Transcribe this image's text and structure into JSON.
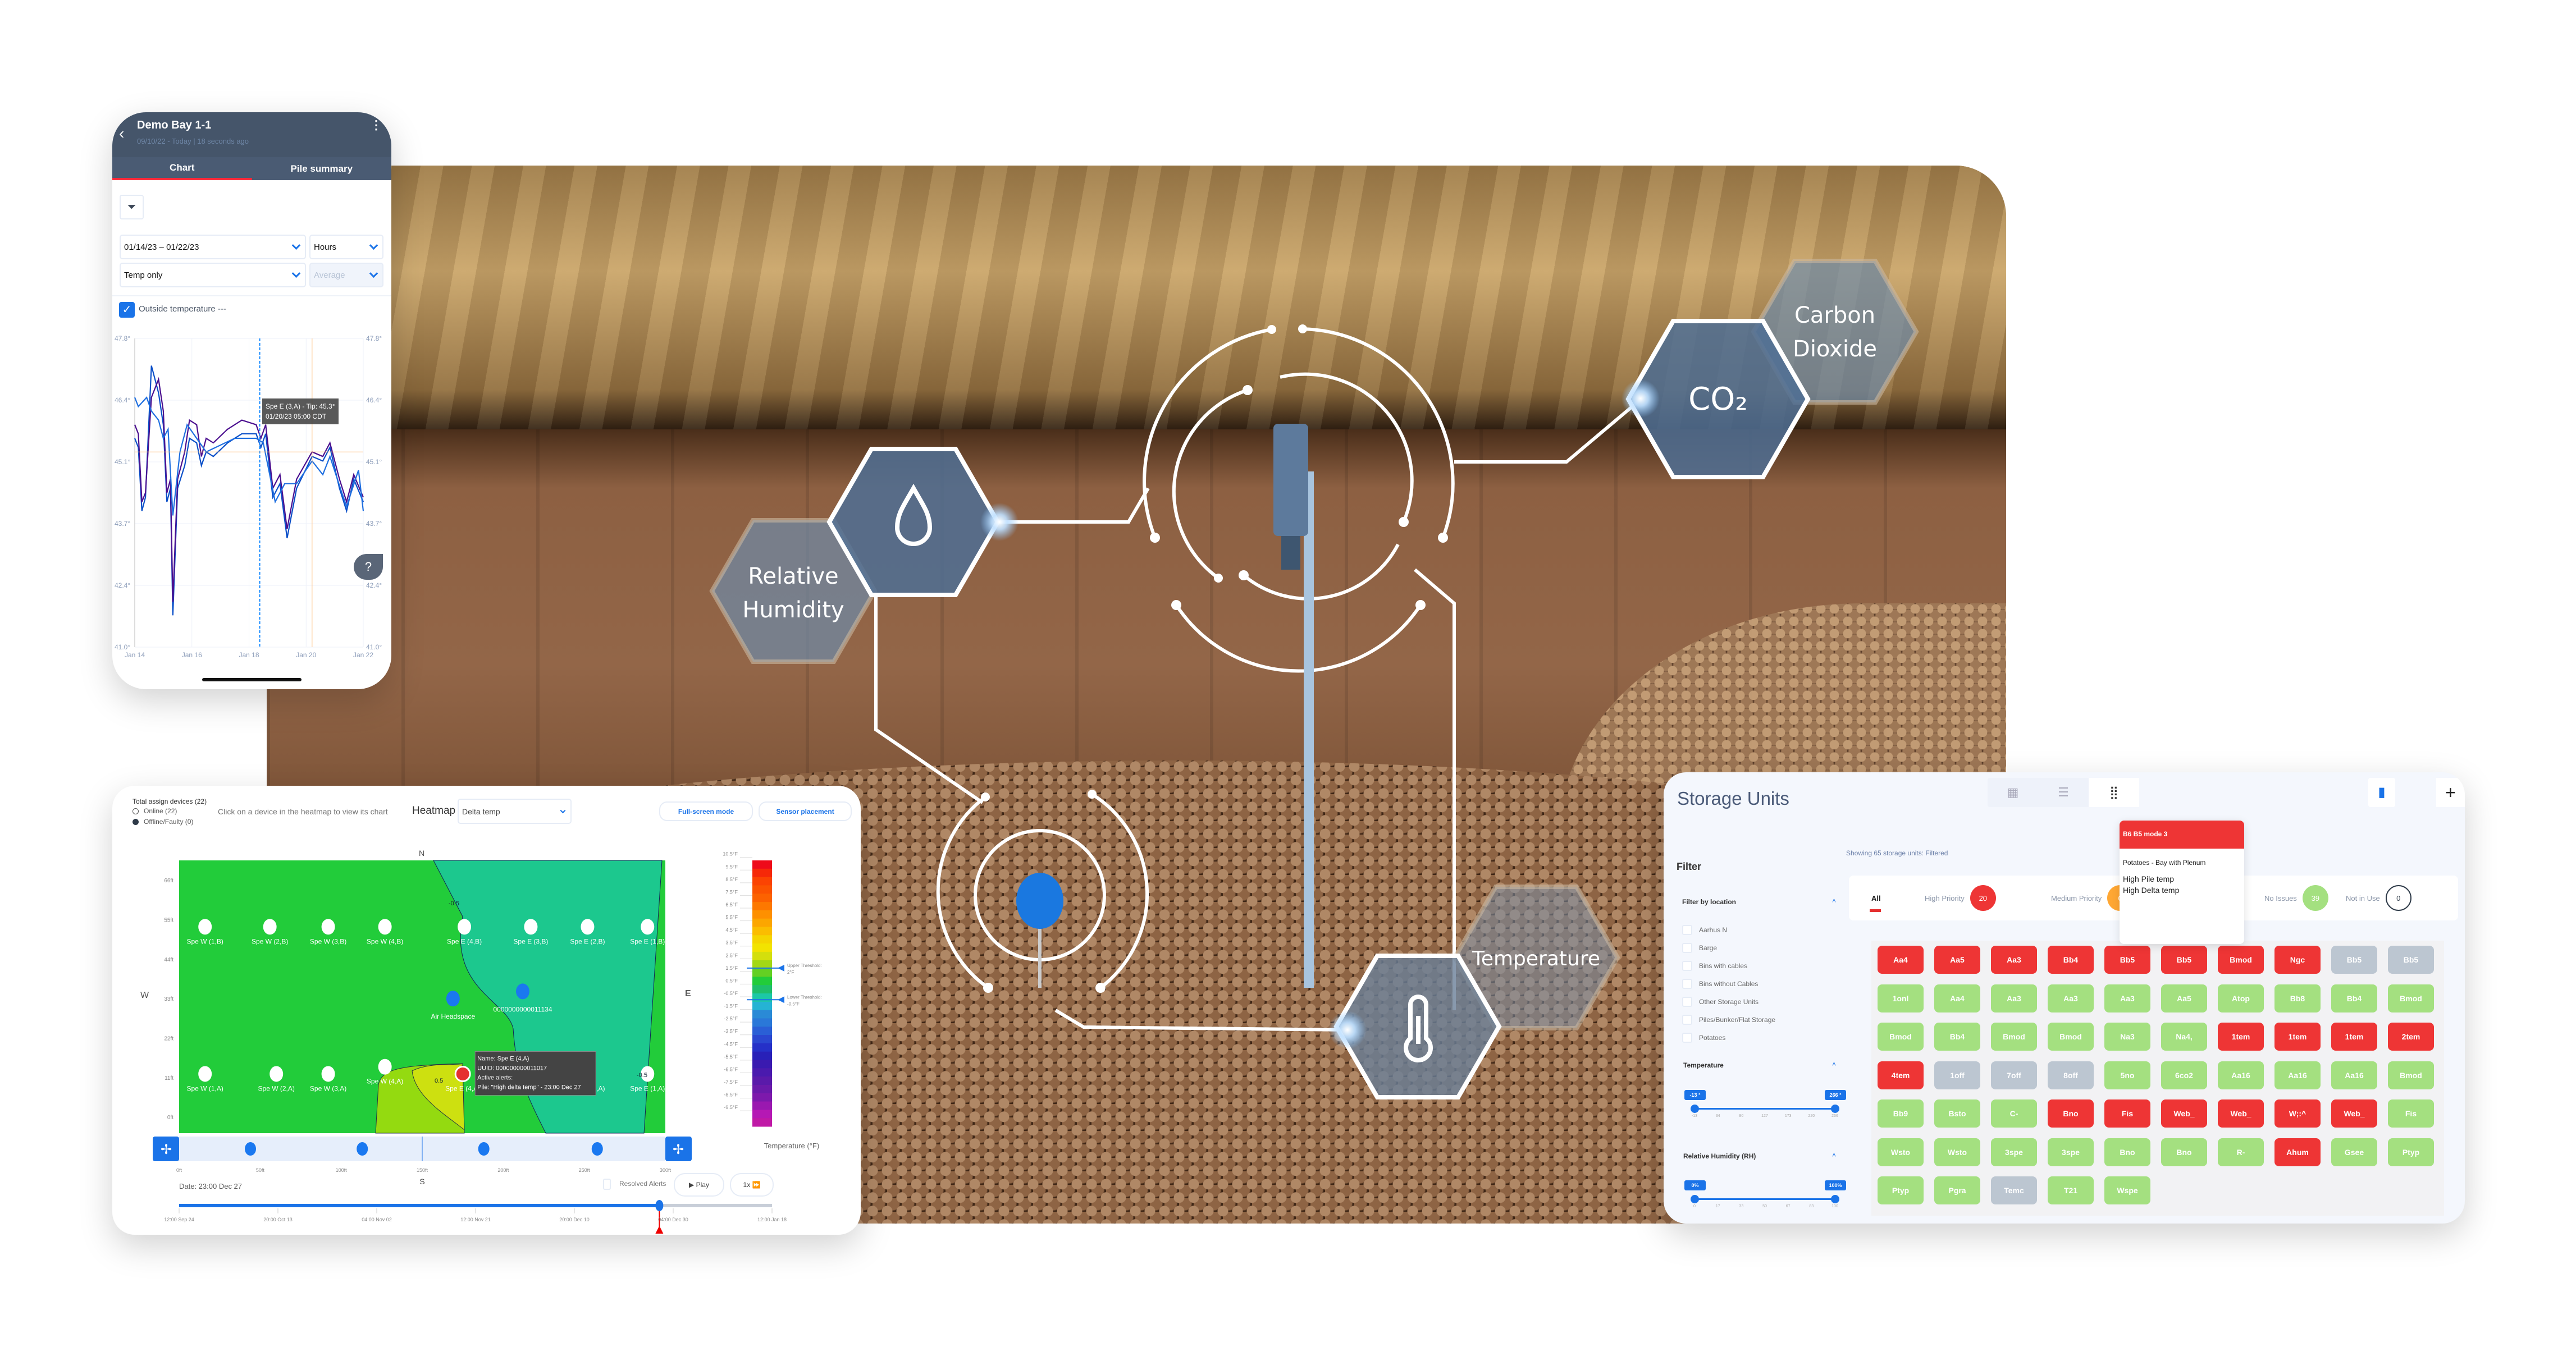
{
  "colors": {
    "accent": "#1a73e8",
    "alert": "#ee3535",
    "ok": "#a4e080",
    "off": "#bcc6d1",
    "header": "#45556a",
    "warn": "#ffa733"
  },
  "overlay": {
    "rh_label": [
      "Relative",
      "Humidity"
    ],
    "co2_symbol": "CO₂",
    "co2_label": [
      "Carbon",
      "Dioxide"
    ],
    "temp_label": "Temperature",
    "icons": [
      "droplet-icon",
      "thermometer-icon"
    ]
  },
  "phone": {
    "title": "Demo Bay 1-1",
    "subtitle": "09/10/22 - Today | 18 seconds ago",
    "tabs": [
      {
        "label": "Chart",
        "active": true
      },
      {
        "label": "Pile summary",
        "active": false
      }
    ],
    "date_range": "01/14/23 – 01/22/23",
    "interval": "Hours",
    "mode": "Temp only",
    "aggregate_placeholder": "Average",
    "outside_temp_label": "Outside temperature ---",
    "outside_temp_checked": true,
    "tooltip": [
      "Spe E (3,A) - Tip: 45.3°",
      "01/20/23 05:00  CDT"
    ]
  },
  "chart_data": {
    "type": "line",
    "title": "",
    "xlabel": "",
    "ylabel": "",
    "ylim": [
      41.0,
      47.8
    ],
    "yticks": [
      "47.8°",
      "46.4°",
      "45.1°",
      "43.7°",
      "42.4°",
      "41.0°"
    ],
    "xlim": [
      "2023-01-14T00:00",
      "2023-01-22T00:00"
    ],
    "xticks": [
      "Jan 14",
      "Jan 16",
      "Jan 18",
      "Jan 20",
      "Jan 22"
    ],
    "grid": true,
    "cursor_x": "2023-01-18T09:00",
    "hover": {
      "x": "2023-01-20T05:00",
      "y": 45.3
    },
    "series": [
      {
        "color": "#0a4fc8",
        "points": [
          [
            "2023-01-14T00:00",
            45.6
          ],
          [
            "2023-01-14T03:00",
            45.4
          ],
          [
            "2023-01-14T06:00",
            44.0
          ],
          [
            "2023-01-14T09:00",
            44.3
          ],
          [
            "2023-01-14T14:00",
            47.2
          ],
          [
            "2023-01-14T20:00",
            46.6
          ],
          [
            "2023-01-15T00:00",
            45.9
          ],
          [
            "2023-01-15T03:00",
            44.2
          ],
          [
            "2023-01-15T06:00",
            44.5
          ],
          [
            "2023-01-15T08:00",
            41.7
          ],
          [
            "2023-01-15T12:00",
            44.5
          ],
          [
            "2023-01-15T18:00",
            45.0
          ],
          [
            "2023-01-15T22:00",
            45.6
          ],
          [
            "2023-01-16T04:00",
            45.5
          ],
          [
            "2023-01-16T08:00",
            45.0
          ],
          [
            "2023-01-16T12:00",
            45.3
          ],
          [
            "2023-01-16T18:00",
            45.2
          ],
          [
            "2023-01-17T06:00",
            45.5
          ],
          [
            "2023-01-17T18:00",
            45.7
          ],
          [
            "2023-01-18T06:00",
            45.7
          ],
          [
            "2023-01-18T10:00",
            45.4
          ],
          [
            "2023-01-18T14:00",
            45.7
          ],
          [
            "2023-01-18T20:00",
            44.3
          ],
          [
            "2023-01-19T02:00",
            44.6
          ],
          [
            "2023-01-19T08:00",
            43.4
          ],
          [
            "2023-01-19T16:00",
            44.5
          ],
          [
            "2023-01-20T05:00",
            45.2
          ],
          [
            "2023-01-20T14:00",
            45.1
          ],
          [
            "2023-01-20T20:00",
            45.4
          ],
          [
            "2023-01-21T04:00",
            44.5
          ],
          [
            "2023-01-21T10:00",
            44.0
          ],
          [
            "2023-01-21T16:00",
            44.7
          ],
          [
            "2023-01-22T00:00",
            44.2
          ]
        ]
      },
      {
        "color": "#4b0f8f",
        "points": [
          [
            "2023-01-14T00:00",
            45.9
          ],
          [
            "2023-01-14T03:00",
            45.7
          ],
          [
            "2023-01-14T06:00",
            44.2
          ],
          [
            "2023-01-14T09:00",
            44.4
          ],
          [
            "2023-01-14T14:00",
            46.5
          ],
          [
            "2023-01-14T20:00",
            46.9
          ],
          [
            "2023-01-15T00:00",
            46.2
          ],
          [
            "2023-01-15T03:00",
            44.4
          ],
          [
            "2023-01-15T06:00",
            44.7
          ],
          [
            "2023-01-15T08:00",
            42.0
          ],
          [
            "2023-01-15T12:00",
            44.7
          ],
          [
            "2023-01-15T18:00",
            45.3
          ],
          [
            "2023-01-15T22:00",
            46.0
          ],
          [
            "2023-01-16T04:00",
            45.9
          ],
          [
            "2023-01-16T08:00",
            45.2
          ],
          [
            "2023-01-16T12:00",
            45.6
          ],
          [
            "2023-01-16T18:00",
            45.5
          ],
          [
            "2023-01-17T06:00",
            45.8
          ],
          [
            "2023-01-17T18:00",
            46.0
          ],
          [
            "2023-01-18T06:00",
            45.9
          ],
          [
            "2023-01-18T10:00",
            45.6
          ],
          [
            "2023-01-18T14:00",
            45.9
          ],
          [
            "2023-01-18T20:00",
            44.5
          ],
          [
            "2023-01-19T02:00",
            44.8
          ],
          [
            "2023-01-19T08:00",
            43.6
          ],
          [
            "2023-01-19T16:00",
            44.7
          ],
          [
            "2023-01-20T05:00",
            45.3
          ],
          [
            "2023-01-20T14:00",
            45.2
          ],
          [
            "2023-01-20T20:00",
            45.5
          ],
          [
            "2023-01-21T04:00",
            44.7
          ],
          [
            "2023-01-21T10:00",
            44.2
          ],
          [
            "2023-01-21T16:00",
            44.8
          ],
          [
            "2023-01-22T00:00",
            44.3
          ]
        ]
      },
      {
        "color": "#1f6fe0",
        "points": [
          [
            "2023-01-14T00:00",
            46.5
          ],
          [
            "2023-01-14T03:00",
            46.3
          ],
          [
            "2023-01-14T10:00",
            46.5
          ],
          [
            "2023-01-14T14:00",
            46.2
          ],
          [
            "2023-01-14T20:00",
            46.0
          ],
          [
            "2023-01-15T00:00",
            45.6
          ],
          [
            "2023-01-15T04:00",
            45.8
          ],
          [
            "2023-01-15T08:00",
            43.9
          ],
          [
            "2023-01-15T14:00",
            45.3
          ],
          [
            "2023-01-15T20:00",
            45.9
          ],
          [
            "2023-01-16T04:00",
            45.6
          ],
          [
            "2023-01-16T12:00",
            45.3
          ],
          [
            "2023-01-16T20:00",
            45.4
          ],
          [
            "2023-01-17T12:00",
            45.6
          ],
          [
            "2023-01-18T06:00",
            45.6
          ],
          [
            "2023-01-18T12:00",
            45.5
          ],
          [
            "2023-01-18T22:00",
            44.2
          ],
          [
            "2023-01-19T06:00",
            44.6
          ],
          [
            "2023-01-19T16:00",
            44.6
          ],
          [
            "2023-01-20T05:00",
            45.1
          ],
          [
            "2023-01-20T14:00",
            44.8
          ],
          [
            "2023-01-20T20:00",
            45.2
          ],
          [
            "2023-01-21T06:00",
            44.4
          ],
          [
            "2023-01-21T10:00",
            44.1
          ],
          [
            "2023-01-21T20:00",
            44.9
          ],
          [
            "2023-01-22T00:00",
            44.0
          ]
        ]
      }
    ]
  },
  "heatmap": {
    "total_devices": "Total assign devices (22)",
    "online": "Online (22)",
    "offline": "Offline/Faulty (0)",
    "hint": "Click on a device in the heatmap to view its chart",
    "label": "Heatmap",
    "metric": "Delta temp",
    "fullscreen": "Full-screen mode",
    "sensor_placement": "Sensor placement",
    "compass": {
      "n": "N",
      "s": "S",
      "w": "W",
      "e": "E"
    },
    "xlim": [
      0,
      300
    ],
    "ylim": [
      -4.5,
      71.5
    ],
    "yticks": [
      "66ft",
      "55ft",
      "44ft",
      "33ft",
      "22ft",
      "11ft",
      "0ft"
    ],
    "xticks": [
      "0ft",
      "50ft",
      "100ft",
      "150ft",
      "200ft",
      "250ft",
      "300ft"
    ],
    "sensors": [
      {
        "name": "Spe W (1,B)",
        "x": 16,
        "y": 53
      },
      {
        "name": "Spe W (2,B)",
        "x": 56,
        "y": 53
      },
      {
        "name": "Spe W (3,B)",
        "x": 92,
        "y": 53
      },
      {
        "name": "Spe W (4,B)",
        "x": 127,
        "y": 53
      },
      {
        "name": "Spe E (4,B)",
        "x": 176,
        "y": 53
      },
      {
        "name": "Spe E (3,B)",
        "x": 217,
        "y": 53
      },
      {
        "name": "Spe E (2,B)",
        "x": 252,
        "y": 53
      },
      {
        "name": "Spe E (1,B)",
        "x": 289,
        "y": 53
      },
      {
        "name": "Spe W (1,A)",
        "x": 16,
        "y": 12
      },
      {
        "name": "Spe W (2,A)",
        "x": 60,
        "y": 12
      },
      {
        "name": "Spe W (3,A)",
        "x": 92,
        "y": 12
      },
      {
        "name": "Spe W (4,A)",
        "x": 127,
        "y": 14
      },
      {
        "name": "Spe E (4,A)",
        "x": 175,
        "y": 12,
        "alert": true
      },
      {
        "name": "Spe E (3,A)",
        "x": 217,
        "y": 12
      },
      {
        "name": "Spe E (2,A)",
        "x": 252,
        "y": 12
      },
      {
        "name": "Spe E (1,A)",
        "x": 289,
        "y": 12
      }
    ],
    "co2_sensors": [
      {
        "name": "Air Headspace",
        "x": 169,
        "y": 33
      },
      {
        "name": "0000000000011134",
        "x": 212,
        "y": 35
      }
    ],
    "contour_labels": [
      "-0.5",
      "0.5",
      "-0.5"
    ],
    "tooltip": [
      "Name: Spe E (4,A)",
      "UUID: 000000000011017",
      "Active alerts:",
      "Pile: \"High delta temp\" - 23:00 Dec 27"
    ],
    "colorbar": {
      "ticks": [
        "10.5°F",
        "9.5°F",
        "8.5°F",
        "7.5°F",
        "6.5°F",
        "5.5°F",
        "4.5°F",
        "3.5°F",
        "2.5°F",
        "1.5°F",
        "0.5°F",
        "-0.5°F",
        "-1.5°F",
        "-2.5°F",
        "-3.5°F",
        "-4.5°F",
        "-5.5°F",
        "-6.5°F",
        "-7.5°F",
        "-8.5°F",
        "-9.5°F"
      ],
      "range": [
        -10.5,
        10.5
      ],
      "colors": [
        "#ee0a1a",
        "#f62808",
        "#fb4302",
        "#fb5300",
        "#fc6200",
        "#fd7800",
        "#fe9000",
        "#fca600",
        "#fbbd00",
        "#f5d500",
        "#f2e300",
        "#d4df0c",
        "#a2d815",
        "#63d023",
        "#22cc3a",
        "#1fbf6b",
        "#1cc8a6",
        "#25b3d4",
        "#2a8ad6",
        "#2a78d8",
        "#2a5fd6",
        "#2a47d0",
        "#2530c8",
        "#2820b8",
        "#3a1ab0",
        "#4a1aae",
        "#5a1aaa",
        "#6a1aaa",
        "#7d19ac",
        "#9a18b0",
        "#b518b4",
        "#c019a6"
      ],
      "upper": {
        "label": "Upper Threshold:",
        "value": "2°F",
        "v": 2
      },
      "lower": {
        "label": "Lower Threshold:",
        "value": "-0.5°F",
        "v": -0.5
      },
      "title": "Temperature (°F)"
    },
    "bottom_co2_x": [
      44,
      113,
      188,
      258
    ],
    "date": "Date: 23:00 Dec 27",
    "resolved_alerts": "Resolved Alerts",
    "play": "Play",
    "speed": "1x",
    "timeline": {
      "ticks": [
        "12:00 Sep 24",
        "20:00 Oct 13",
        "04:00 Nov 02",
        "12:00 Nov 21",
        "20:00 Dec 10",
        "04:00 Dec 30",
        "12:00 Jan 18"
      ],
      "progress": 0.81
    }
  },
  "storage": {
    "title": "Storage Units",
    "filter": "Filter",
    "showing": "Showing 65 storage units: Filtered",
    "tabs": [
      {
        "label": "All",
        "count": null,
        "color": null,
        "active": true
      },
      {
        "label": "High Priority",
        "count": "20",
        "color": "#ee3535"
      },
      {
        "label": "Medium Priority",
        "count": "0",
        "color": "#ffa733"
      },
      {
        "label": "No Issues",
        "count": "39",
        "color": "#a4e080"
      },
      {
        "label": "Not in Use",
        "count": "0",
        "color": "outline"
      }
    ],
    "tooltip": {
      "title": "B6 B5 mode 3",
      "type": "Potatoes - Bay with Plenum",
      "alerts": [
        "High Pile temp",
        "High Delta temp"
      ]
    },
    "filter_location": "Filter by location",
    "locations": [
      "Aarhus N",
      "Barge",
      "Bins with cables",
      "Bins without Cables",
      "Other Storage Units",
      "Piles/Bunker/Flat Storage",
      "Potatoes"
    ],
    "temperature": {
      "label": "Temperature",
      "min": "-13 °",
      "max": "266 °",
      "ticks": [
        "-13",
        "34",
        "80",
        "127",
        "173",
        "220",
        "266"
      ]
    },
    "humidity": {
      "label": "Relative Humidity (RH)",
      "min": "0%",
      "max": "100%",
      "ticks": [
        "0",
        "17",
        "33",
        "50",
        "67",
        "83",
        "100"
      ]
    },
    "tiles": [
      [
        [
          "Aa4",
          "r"
        ],
        [
          "Aa5",
          "r"
        ],
        [
          "Aa3",
          "r"
        ],
        [
          "Bb4",
          "r"
        ],
        [
          "Bb5",
          "r"
        ],
        [
          "Bb5",
          "r"
        ],
        [
          "Bmod",
          "r"
        ],
        [
          "Ngc",
          "r"
        ],
        [
          "Bb5",
          "x"
        ],
        [
          "Bb5",
          "x"
        ]
      ],
      [
        [
          "1onl",
          "g"
        ],
        [
          "Aa4",
          "g"
        ],
        [
          "Aa3",
          "g"
        ],
        [
          "Aa3",
          "g"
        ],
        [
          "Aa3",
          "g"
        ],
        [
          "Aa5",
          "g"
        ],
        [
          "Atop",
          "g"
        ],
        [
          "Bb8",
          "g"
        ],
        [
          "Bb4",
          "g"
        ],
        [
          "Bmod",
          "g"
        ]
      ],
      [
        [
          "Bmod",
          "g"
        ],
        [
          "Bb4",
          "g"
        ],
        [
          "Bmod",
          "g"
        ],
        [
          "Bmod",
          "g"
        ],
        [
          "Na3",
          "g"
        ],
        [
          "Na4,",
          "g"
        ],
        [
          "1tem",
          "r"
        ],
        [
          "1tem",
          "r"
        ],
        [
          "1tem",
          "r"
        ],
        [
          "2tem",
          "r"
        ]
      ],
      [
        [
          "4tem",
          "r"
        ],
        [
          "1off",
          "x"
        ],
        [
          "7off",
          "x"
        ],
        [
          "8off",
          "x"
        ],
        [
          "5no",
          "g"
        ],
        [
          "6co2",
          "g"
        ],
        [
          "Aa16",
          "g"
        ],
        [
          "Aa16",
          "g"
        ],
        [
          "Aa16",
          "g"
        ],
        [
          "Bmod",
          "g"
        ]
      ],
      [
        [
          "Bb9",
          "g"
        ],
        [
          "Bsto",
          "g"
        ],
        [
          "C-",
          "g"
        ],
        [
          "Bno",
          "r"
        ],
        [
          "Fis",
          "r"
        ],
        [
          "Web_",
          "r"
        ],
        [
          "Web_",
          "r"
        ],
        [
          "W;:^",
          "r"
        ],
        [
          "Web_",
          "r"
        ],
        [
          "Fis",
          "g"
        ]
      ],
      [
        [
          "Wsto",
          "g"
        ],
        [
          "Wsto",
          "g"
        ],
        [
          "3spe",
          "g"
        ],
        [
          "3spe",
          "g"
        ],
        [
          "Bno",
          "g"
        ],
        [
          "Bno",
          "g"
        ],
        [
          "R-",
          "g"
        ],
        [
          "Ahum",
          "r"
        ],
        [
          "Gsee",
          "g"
        ],
        [
          "Ptyp",
          "g"
        ]
      ],
      [
        [
          "Ptyp",
          "g"
        ],
        [
          "Pgra",
          "g"
        ],
        [
          "Temc",
          "x"
        ],
        [
          "T21",
          "g"
        ],
        [
          "Wspe",
          "g"
        ]
      ]
    ]
  }
}
